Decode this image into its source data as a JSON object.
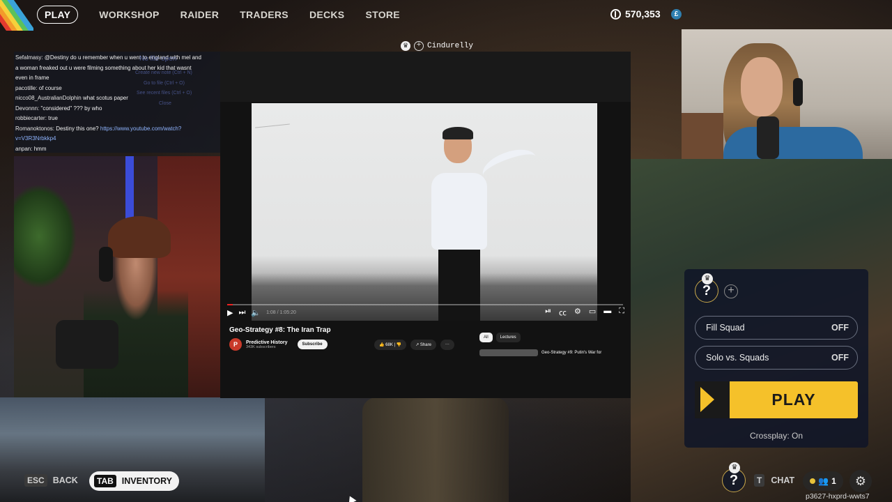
{
  "nav": {
    "items": [
      {
        "label": "PLAY",
        "active": true
      },
      {
        "label": "WORKSHOP"
      },
      {
        "label": "RAIDER"
      },
      {
        "label": "TRADERS"
      },
      {
        "label": "DECKS"
      },
      {
        "label": "STORE"
      }
    ],
    "currency": "570,353"
  },
  "chat": {
    "lines": [
      {
        "user": "Sefalmasy:",
        "text": "@Destiny do u remember when u went to england with mel and"
      },
      {
        "user": "",
        "text": "a woman freaked out u were filming something about her kid that wasnt"
      },
      {
        "user": "",
        "text": "even in frame"
      },
      {
        "user": "pacotille:",
        "text": "of course"
      },
      {
        "user": "nicco08_AustralianDolphin",
        "text": "what scotus paper"
      },
      {
        "user": "Devonnn:",
        "text": "\"considered\" ??? by who"
      },
      {
        "user": "robbiecarter:",
        "text": "true"
      },
      {
        "user": "Romanoktonos:",
        "text": "Destiny this one?",
        "link": "https://www.youtube.com/watch?"
      },
      {
        "user": "",
        "text": "",
        "link": "v=V3R3Nrbkkp4"
      },
      {
        "user": "anpan:",
        "text": "hmm"
      }
    ],
    "ghost_menu": [
      "No file open",
      "Create new note (Ctrl + N)",
      "Go to file (Ctrl + O)",
      "See recent files (Ctrl + O)",
      "Close"
    ]
  },
  "player_tag": {
    "name": "Cindurelly"
  },
  "video": {
    "time": "1:08 / 1:05:20",
    "title": "Geo-Strategy #8: The Iran Trap",
    "channel": "Predictive History",
    "channel_initial": "P",
    "subscribers": "343K subscribers",
    "subscribe_label": "Subscribe",
    "likes": "68K",
    "share_label": "Share",
    "more_label": "···",
    "chips": [
      "All",
      "Lectures"
    ],
    "recommendation": "Geo-Strategy #9: Putin's War for"
  },
  "squad": {
    "slot_label": "?",
    "fill_squad": {
      "label": "Fill Squad",
      "state": "OFF"
    },
    "solo_vs_squads": {
      "label": "Solo vs. Squads",
      "state": "OFF"
    },
    "play_label": "PLAY",
    "crossplay": "Crossplay: On"
  },
  "hints": {
    "back_key": "ESC",
    "back_label": "BACK",
    "inv_key": "TAB",
    "inv_label": "INVENTORY",
    "chat_key": "T",
    "chat_label": "CHAT",
    "party_count": "1"
  },
  "session_code": "p3627-hxprd-wwts7",
  "colors": {
    "accent_yellow": "#f5c12a",
    "panel_navy": "#101628"
  }
}
